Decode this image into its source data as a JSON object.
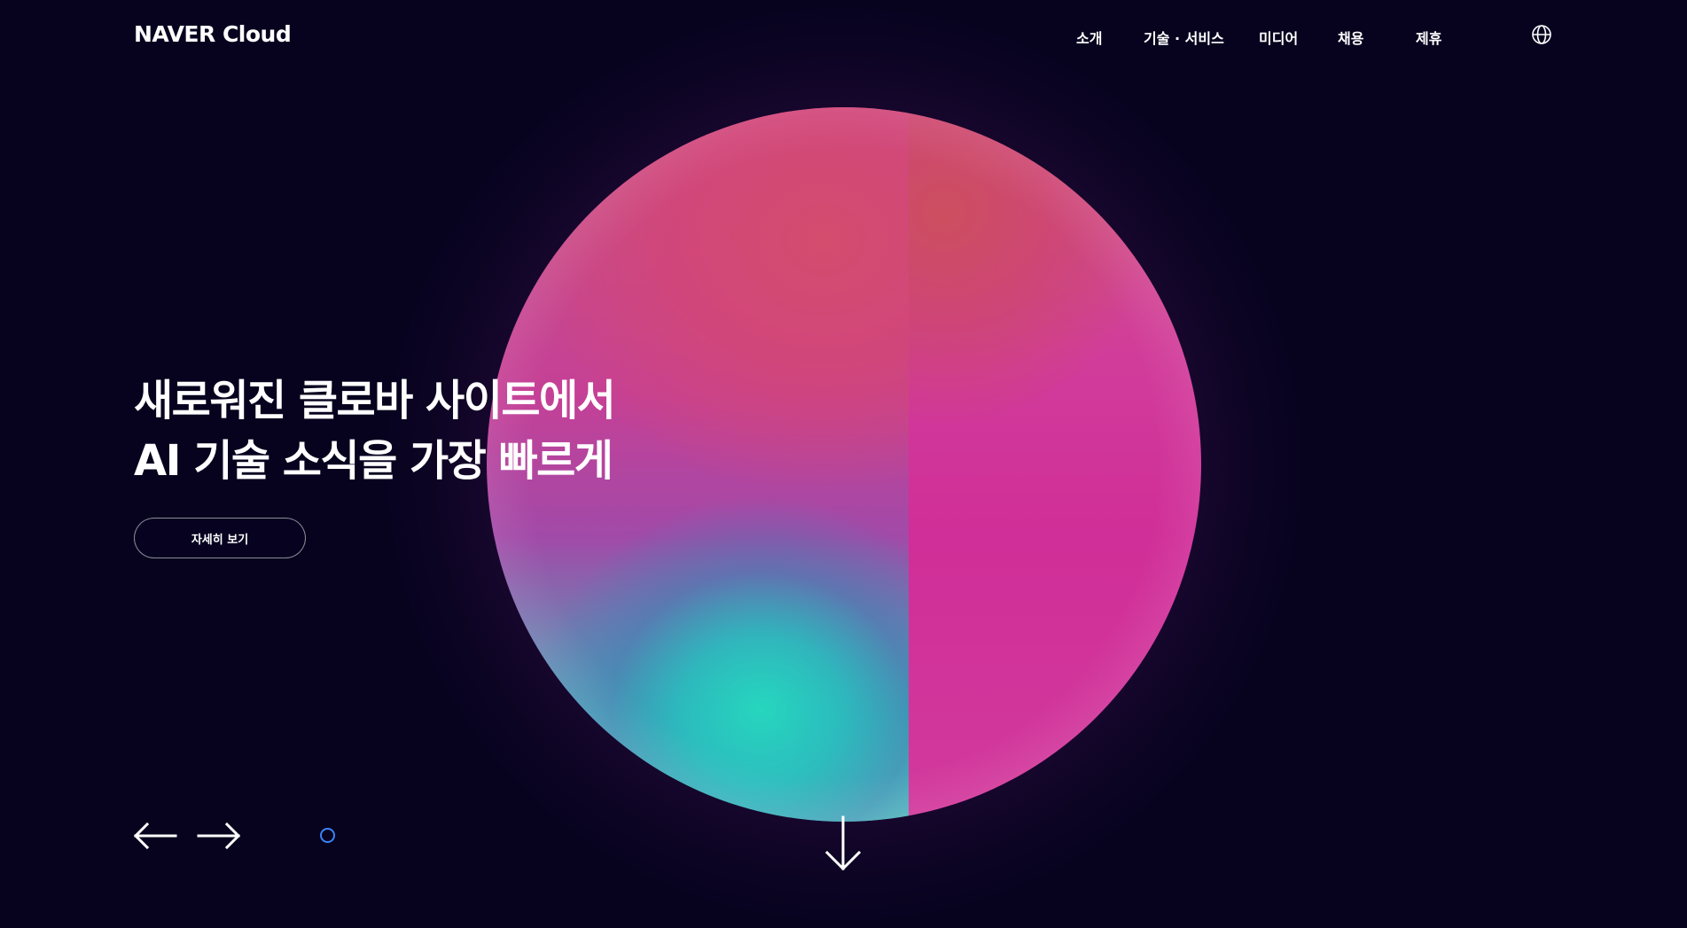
{
  "brand": {
    "logo_text": "NAVER Cloud"
  },
  "nav": {
    "items": [
      {
        "label": "소개"
      },
      {
        "label": "기술 · 서비스"
      },
      {
        "label": "미디어"
      },
      {
        "label": "채용"
      },
      {
        "label": "제휴"
      }
    ],
    "language_icon": "globe-icon"
  },
  "hero": {
    "line1": "새로워진 클로바 사이트에서",
    "line2": "AI 기술 소식을 가장 빠르게",
    "cta_label": "자세히 보기"
  },
  "carousel": {
    "prev_icon": "arrow-left-icon",
    "next_icon": "arrow-right-icon",
    "indicator_color": "#3b82f6",
    "slide_count": 1,
    "active_index": 0
  },
  "scroll": {
    "icon": "arrow-down-icon"
  },
  "colors": {
    "background": "#07031f",
    "text": "#ffffff",
    "sphere_pink": "#d02e98",
    "sphere_red": "#cf4f6e",
    "sphere_teal": "#26d6be"
  }
}
